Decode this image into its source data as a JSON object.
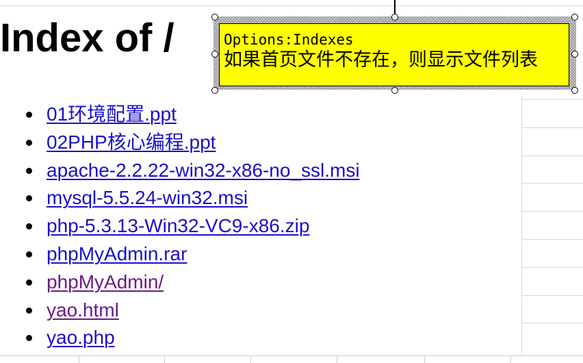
{
  "page": {
    "title": "Index of /"
  },
  "files": [
    {
      "name": "01环境配置.ppt",
      "visited": false
    },
    {
      "name": "02PHP核心编程.ppt",
      "visited": false
    },
    {
      "name": "apache-2.2.22-win32-x86-no_ssl.msi",
      "visited": false
    },
    {
      "name": "mysql-5.5.24-win32.msi",
      "visited": false
    },
    {
      "name": "php-5.3.13-Win32-VC9-x86.zip",
      "visited": false
    },
    {
      "name": "phpMyAdmin.rar",
      "visited": false
    },
    {
      "name": "phpMyAdmin/",
      "visited": true
    },
    {
      "name": "yao.html",
      "visited": true
    },
    {
      "name": "yao.php",
      "visited": false
    }
  ],
  "callout": {
    "line1": "Options:Indexes",
    "line2": "如果首页文件不存在，则显示文件列表"
  },
  "colors": {
    "link": "#1a10c8",
    "visited": "#6a1a8a",
    "callout_fill": "#ffff00"
  }
}
